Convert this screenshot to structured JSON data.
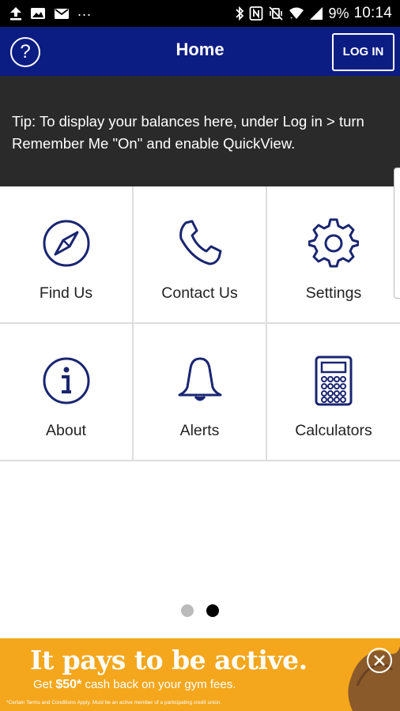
{
  "status_bar": {
    "battery": "9%",
    "time": "10:14",
    "overflow": "..."
  },
  "app_bar": {
    "help_symbol": "?",
    "title": "Home",
    "login_label": "LOG IN"
  },
  "tip": {
    "text": "Tip: To display your balances here, under Log in > turn Remember Me \"On\" and enable QuickView."
  },
  "tiles": [
    {
      "label": "Find Us",
      "icon": "compass-icon"
    },
    {
      "label": "Contact Us",
      "icon": "phone-icon"
    },
    {
      "label": "Settings",
      "icon": "gear-icon"
    },
    {
      "label": "About",
      "icon": "info-icon"
    },
    {
      "label": "Alerts",
      "icon": "bell-icon"
    },
    {
      "label": "Calculators",
      "icon": "calculator-icon"
    }
  ],
  "pager": {
    "pages": 2,
    "active_page": 2
  },
  "ad": {
    "headline": "It pays to be active.",
    "sub_prefix": "Get ",
    "sub_amount": "$50*",
    "sub_suffix": " cash back on your gym fees.",
    "fine_print": "*Certain Terms and Conditions Apply. Must be an active member of a participating credit union."
  },
  "colors": {
    "navy": "#0b1d83",
    "tip_bg": "#2a2a2a",
    "ad_orange": "#f4a71d",
    "icon_stroke": "#1a2570"
  }
}
